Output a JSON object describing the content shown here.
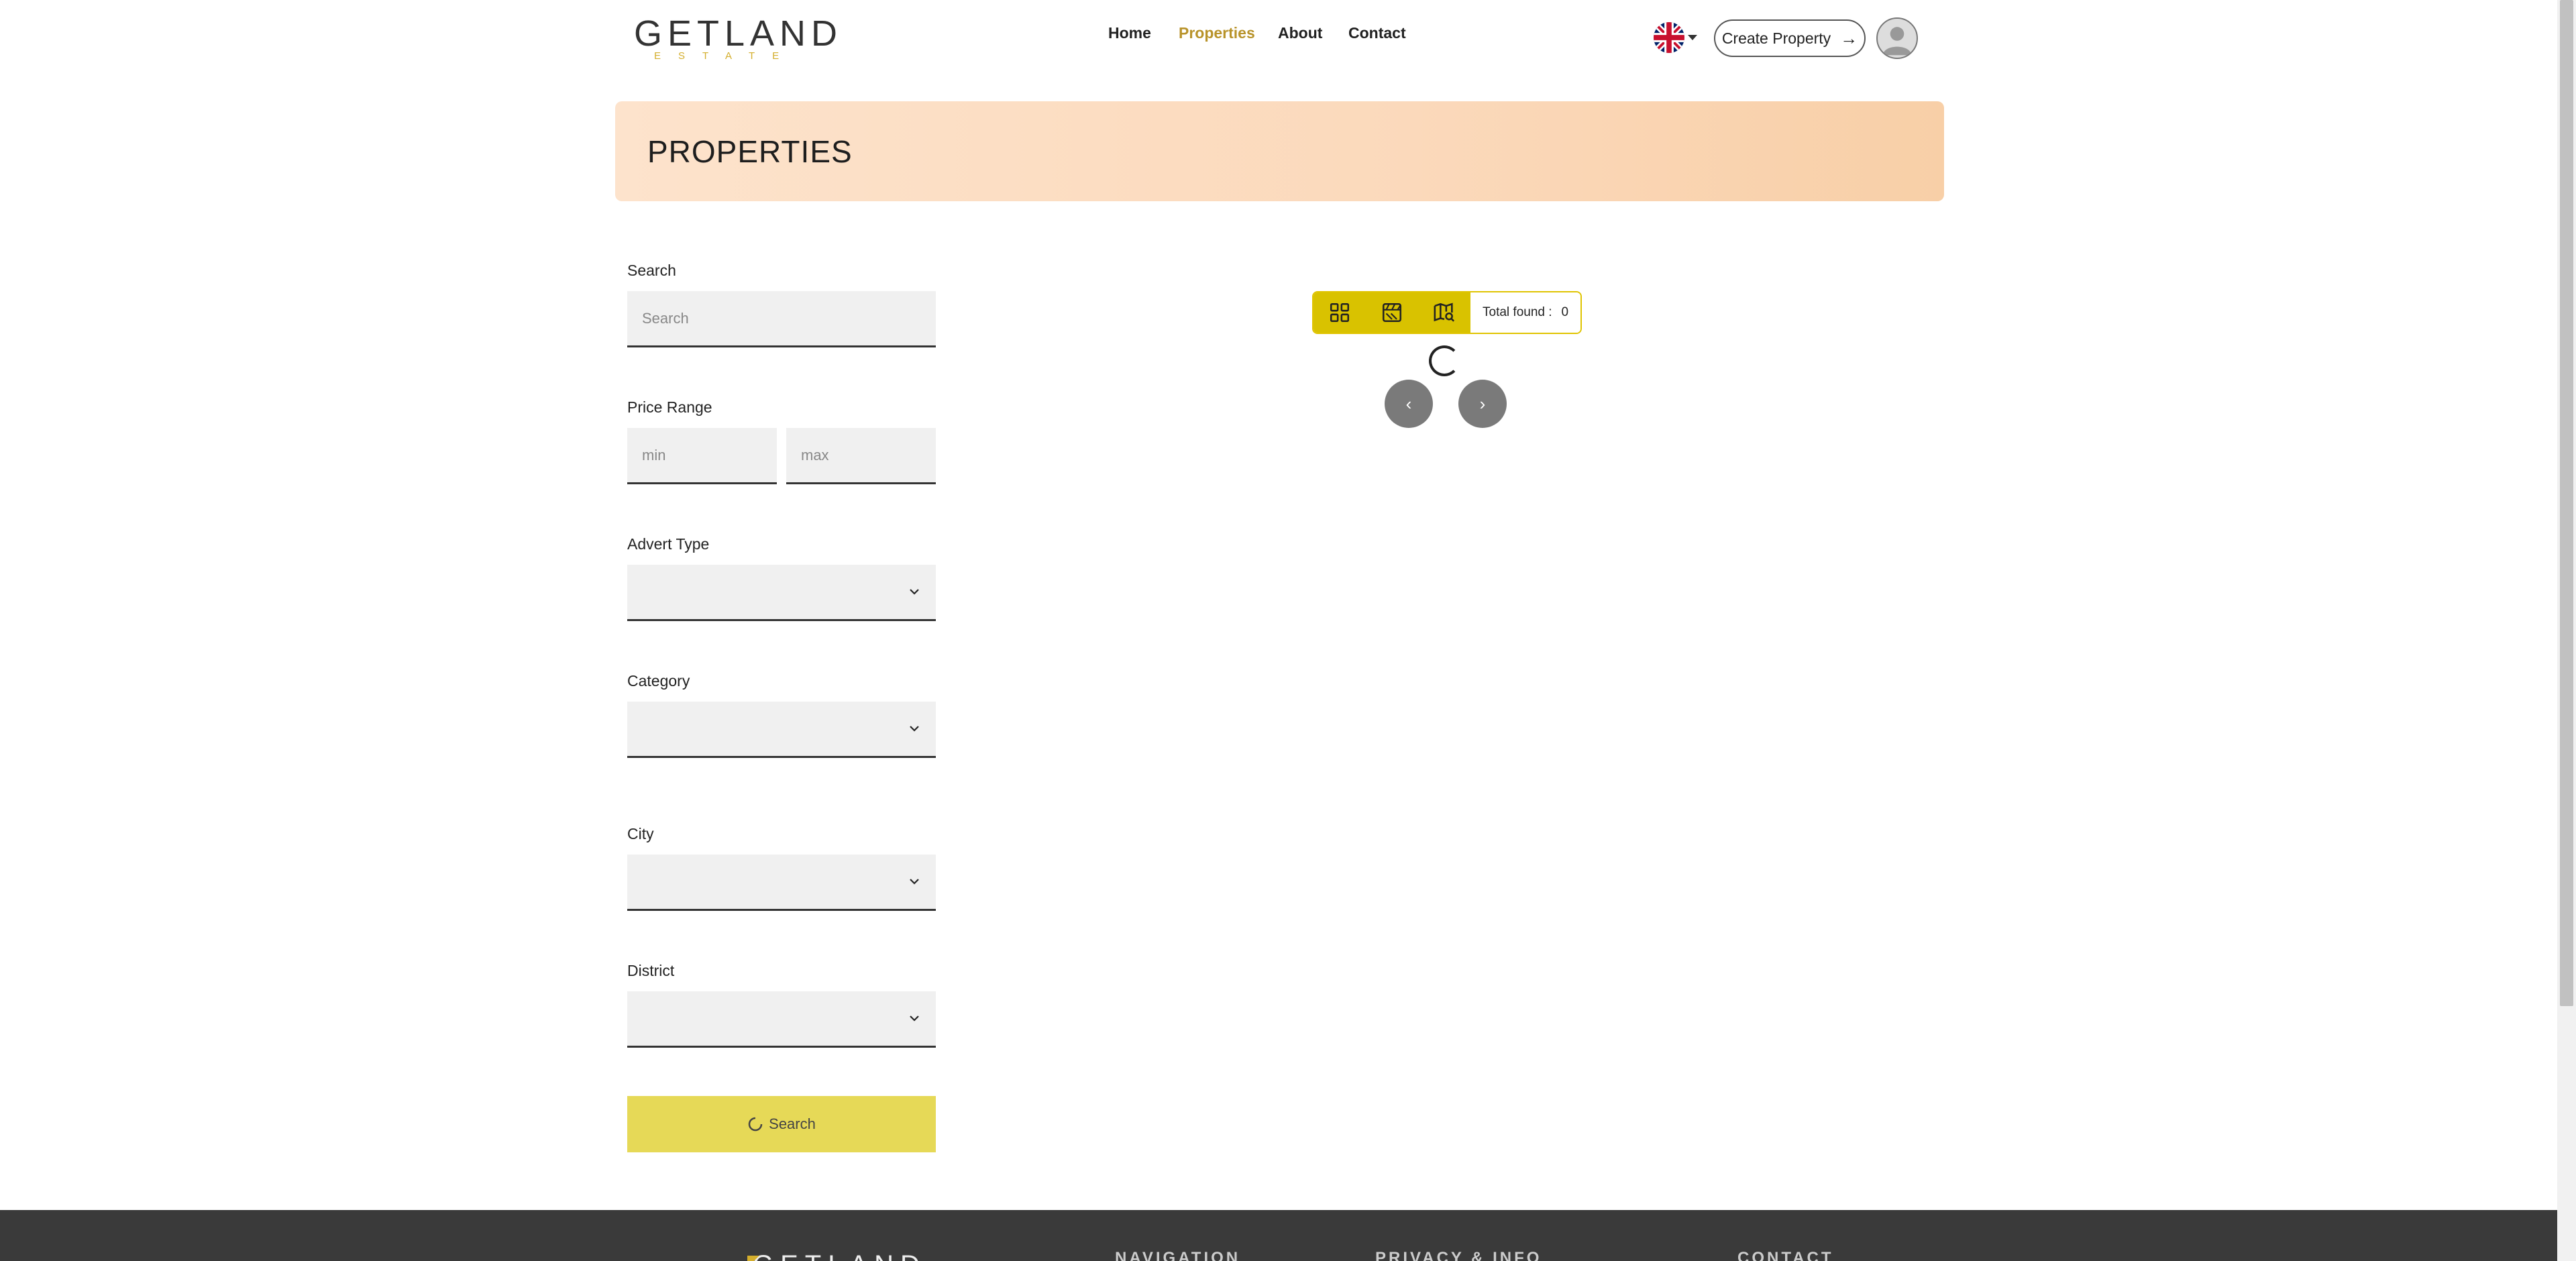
{
  "header": {
    "logo": {
      "name": "GETLAND",
      "sub": "ESTATE"
    },
    "nav": [
      {
        "label": "Home"
      },
      {
        "label": "Properties",
        "active": true
      },
      {
        "label": "About"
      },
      {
        "label": "Contact"
      }
    ],
    "language_icon": "uk-flag-icon",
    "create_label": "Create Property",
    "create_icon": "arrow-right-icon",
    "avatar_icon": "user-avatar-icon"
  },
  "banner": {
    "title": "PROPERTIES"
  },
  "filters": {
    "search": {
      "label": "Search",
      "placeholder": "Search",
      "value": ""
    },
    "price": {
      "label": "Price Range",
      "min_placeholder": "min",
      "max_placeholder": "max"
    },
    "advert_type": {
      "label": "Advert Type",
      "value": ""
    },
    "category": {
      "label": "Category",
      "value": ""
    },
    "city": {
      "label": "City",
      "value": ""
    },
    "district": {
      "label": "District",
      "value": ""
    },
    "submit_label": "Search"
  },
  "results": {
    "view_icons": [
      "grid-view-icon",
      "gallery-view-icon",
      "map-view-icon"
    ],
    "total_label": "Total found :",
    "total_value": "0",
    "prev_icon": "chevron-left-icon",
    "next_icon": "chevron-right-icon"
  },
  "footer": {
    "logo": "GETLAND",
    "headings": [
      "NAVIGATION",
      "PRIVACY & INFO",
      "CONTACT"
    ]
  },
  "colors": {
    "accent": "#d9c200",
    "active_nav": "#b8932a",
    "submit_bg": "#e6d957",
    "footer_bg": "#3a3a3a"
  }
}
